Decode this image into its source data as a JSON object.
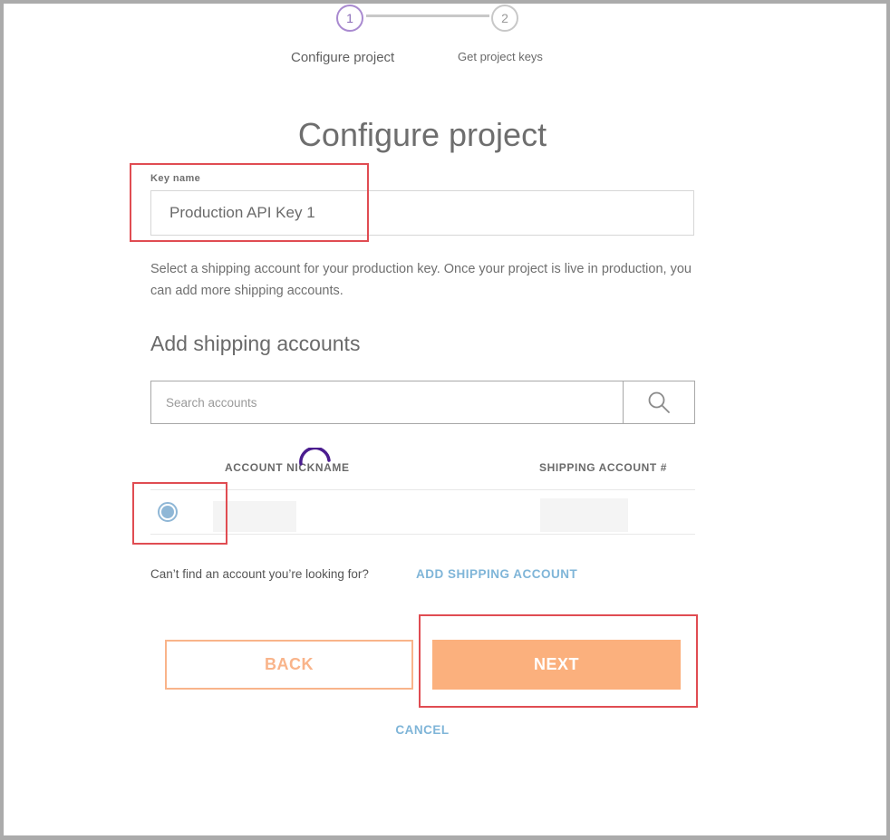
{
  "stepper": {
    "steps": [
      {
        "number": "1",
        "label": "Configure project",
        "state": "active"
      },
      {
        "number": "2",
        "label": "Get project keys",
        "state": "inactive"
      }
    ]
  },
  "main": {
    "title": "Configure project",
    "key_name": {
      "label": "Key name",
      "value": "Production API Key 1"
    },
    "description": "Select a shipping account for your production key. Once your project is live in production, you can add more shipping accounts.",
    "section_title": "Add shipping accounts",
    "search": {
      "placeholder": "Search accounts",
      "icon": "search-icon"
    },
    "table": {
      "columns": [
        "ACCOUNT NICKNAME",
        "SHIPPING ACCOUNT #"
      ],
      "rows": [
        {
          "selected": true,
          "nickname": "",
          "account_number": ""
        }
      ]
    },
    "hint": {
      "text": "Can’t find an account you’re looking for?",
      "link": "ADD SHIPPING ACCOUNT"
    },
    "buttons": {
      "back": "BACK",
      "next": "NEXT",
      "cancel": "CANCEL"
    }
  },
  "colors": {
    "accent_orange": "#fbb07d",
    "link_blue": "#7fb5d8",
    "step_active": "#a98ad0",
    "annotation_red": "#e04c52",
    "spinner": "#4b1d8f"
  }
}
